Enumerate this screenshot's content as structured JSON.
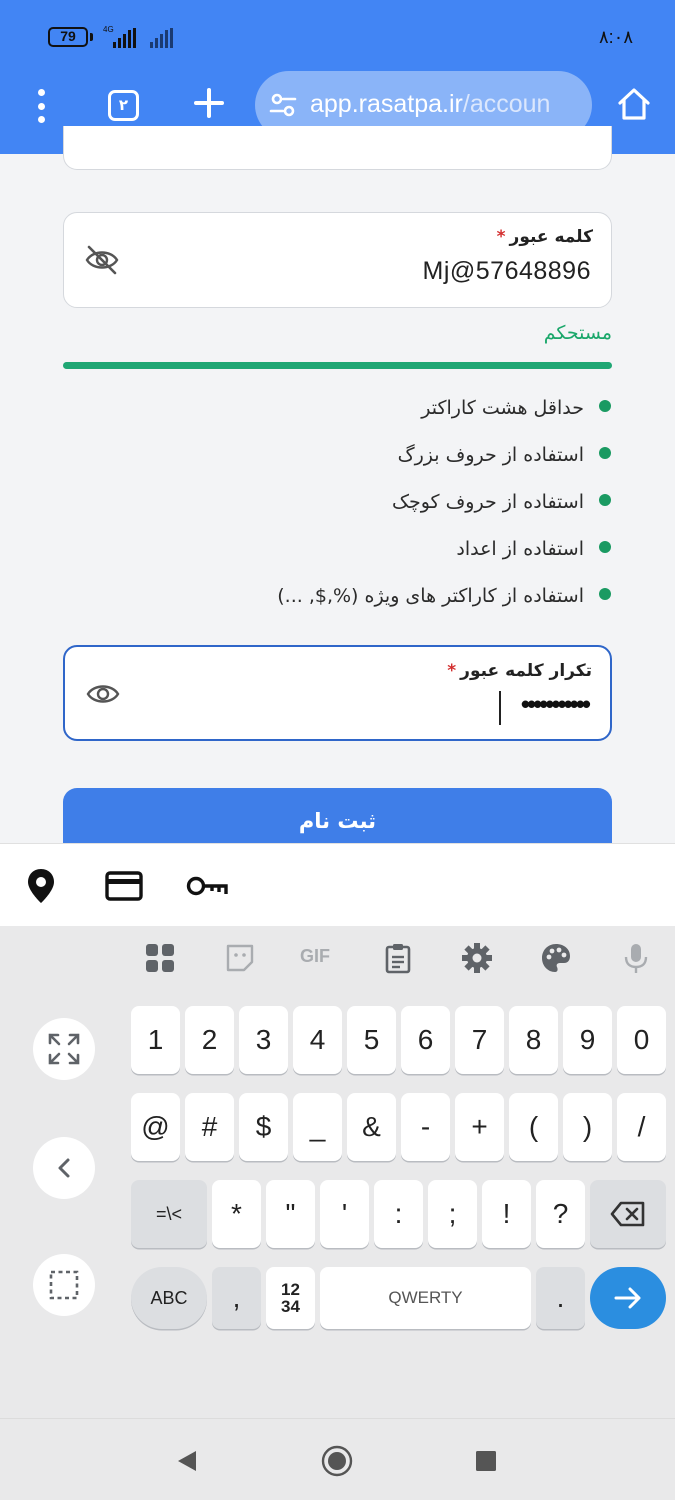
{
  "status_bar": {
    "battery": "79",
    "network": "4G",
    "time": "۸:۰۸"
  },
  "browser": {
    "tab_count": "۲",
    "url_host": "app.rasatpa.ir",
    "url_path": "/accoun"
  },
  "form": {
    "password": {
      "label": "کلمه عبور",
      "required_mark": "*",
      "value": "Mj@57648896"
    },
    "strength": {
      "label": "مستحکم",
      "level": 1.0,
      "color": "#1fa774"
    },
    "rules": [
      "حداقل هشت کاراکتر",
      "استفاده از حروف بزرگ",
      "استفاده از حروف کوچک",
      "استفاده از اعداد",
      "استفاده از کاراکتر های ویژه (%,$, ...)"
    ],
    "confirm_password": {
      "label": "تکرار کلمه عبور",
      "required_mark": "*",
      "masked_value": "•••••••••••"
    },
    "submit_label": "ثبت نام"
  },
  "autofill_bar": {
    "icons": [
      "location-pin-icon",
      "credit-card-icon",
      "key-icon"
    ]
  },
  "keyboard": {
    "toolbar_icons": [
      "apps-grid-icon",
      "sticker-icon",
      "gif-icon",
      "clipboard-icon",
      "settings-gear-icon",
      "theme-palette-icon",
      "microphone-icon"
    ],
    "gif_label": "GIF",
    "row1": [
      "1",
      "2",
      "3",
      "4",
      "5",
      "6",
      "7",
      "8",
      "9",
      "0"
    ],
    "row2": [
      "@",
      "#",
      "$",
      "_",
      "&",
      "-",
      "+",
      "(",
      ")",
      "/"
    ],
    "row3_switch": "=\\<",
    "row3": [
      "*",
      "\"",
      "'",
      ":",
      ";",
      "!",
      "?"
    ],
    "abc_label": "ABC",
    "comma_label": ",",
    "numpad_label_top": "12",
    "numpad_label_bottom": "34",
    "space_label": "QWERTY",
    "period_label": ".",
    "accent_color": "#2b8ee0"
  }
}
